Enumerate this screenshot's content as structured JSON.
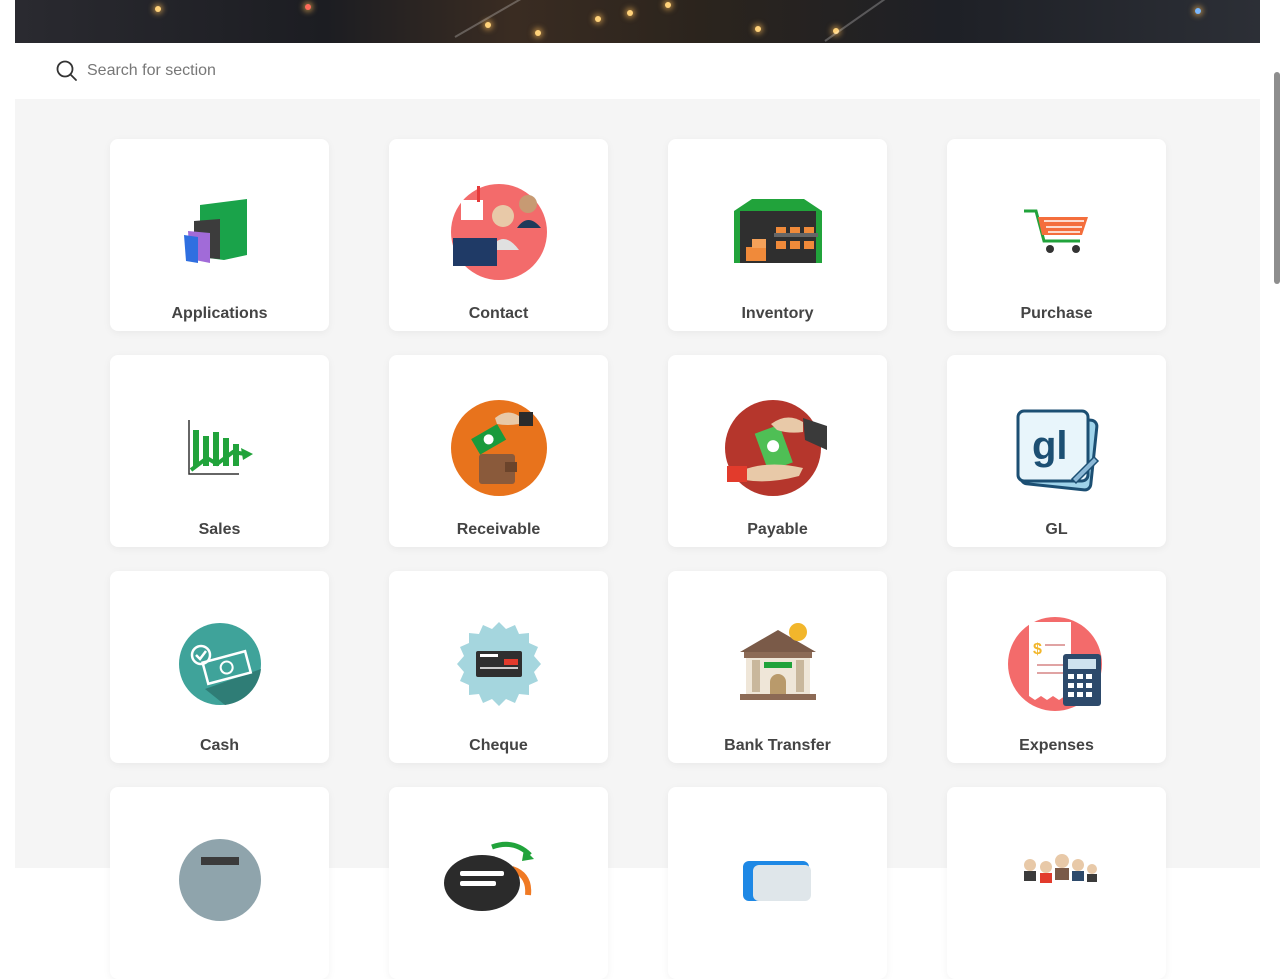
{
  "search": {
    "placeholder": "Search for section",
    "value": ""
  },
  "sections": [
    {
      "label": "Applications",
      "icon": "applications-icon"
    },
    {
      "label": "Contact",
      "icon": "contact-icon"
    },
    {
      "label": "Inventory",
      "icon": "inventory-warehouse-icon"
    },
    {
      "label": "Purchase",
      "icon": "shopping-cart-icon"
    },
    {
      "label": "Sales",
      "icon": "sales-chart-icon"
    },
    {
      "label": "Receivable",
      "icon": "receivable-wallet-icon"
    },
    {
      "label": "Payable",
      "icon": "payable-hand-money-icon"
    },
    {
      "label": "GL",
      "icon": "gl-icon"
    },
    {
      "label": "Cash",
      "icon": "cash-icon"
    },
    {
      "label": "Cheque",
      "icon": "cheque-icon"
    },
    {
      "label": "Bank Transfer",
      "icon": "bank-icon"
    },
    {
      "label": "Expenses",
      "icon": "expenses-calculator-icon"
    },
    {
      "label": "",
      "icon": "partial-gray-icon"
    },
    {
      "label": "",
      "icon": "partial-sync-icon"
    },
    {
      "label": "",
      "icon": "partial-blue-card-icon"
    },
    {
      "label": "",
      "icon": "partial-people-icon"
    }
  ]
}
